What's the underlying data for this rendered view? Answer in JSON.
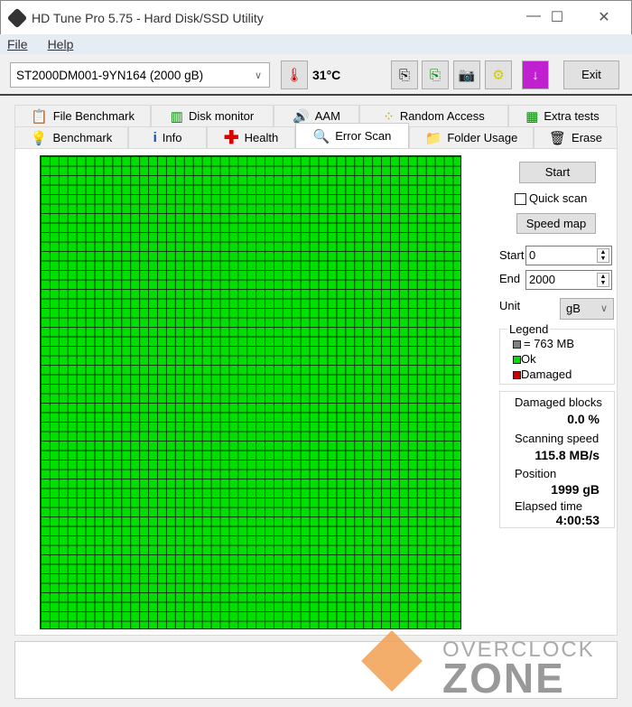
{
  "window": {
    "title": "HD Tune Pro 5.75 - Hard Disk/SSD Utility",
    "minimize": "—",
    "maximize": "☐",
    "close": "✕"
  },
  "menu": {
    "file": "File",
    "help": "Help"
  },
  "toolbar": {
    "drive": "ST2000DM001-9YN164 (2000 gB)",
    "temperature": "31°C",
    "exit": "Exit"
  },
  "tabs_top": [
    "File Benchmark",
    "Disk monitor",
    "AAM",
    "Random Access",
    "Extra tests"
  ],
  "tabs_bottom": [
    "Benchmark",
    "Info",
    "Health",
    "Error Scan",
    "Folder Usage",
    "Erase"
  ],
  "active_tab": "Error Scan",
  "scan": {
    "start_button": "Start",
    "quick_scan": "Quick scan",
    "quick_scan_checked": false,
    "speed_map": "Speed map",
    "start_label": "Start",
    "start_value": "0",
    "end_label": "End",
    "end_value": "2000",
    "unit_label": "Unit",
    "unit_value": "gB",
    "legend": {
      "title": "Legend",
      "block": "= 763 MB",
      "ok": "Ok",
      "damaged": "Damaged"
    },
    "stats": {
      "damaged_label": "Damaged blocks",
      "damaged_value": "0.0 %",
      "speed_label": "Scanning speed",
      "speed_value": "115.8 MB/s",
      "position_label": "Position",
      "position_value": "1999 gB",
      "elapsed_label": "Elapsed time",
      "elapsed_value": "4:00:53"
    },
    "progress_ok_fraction": 1.0
  },
  "colors": {
    "ok": "#00e000",
    "damaged": "#d00000",
    "block": "#808080"
  },
  "watermark": {
    "line1": "OVERCLOCK",
    "line2": "ZONE"
  }
}
